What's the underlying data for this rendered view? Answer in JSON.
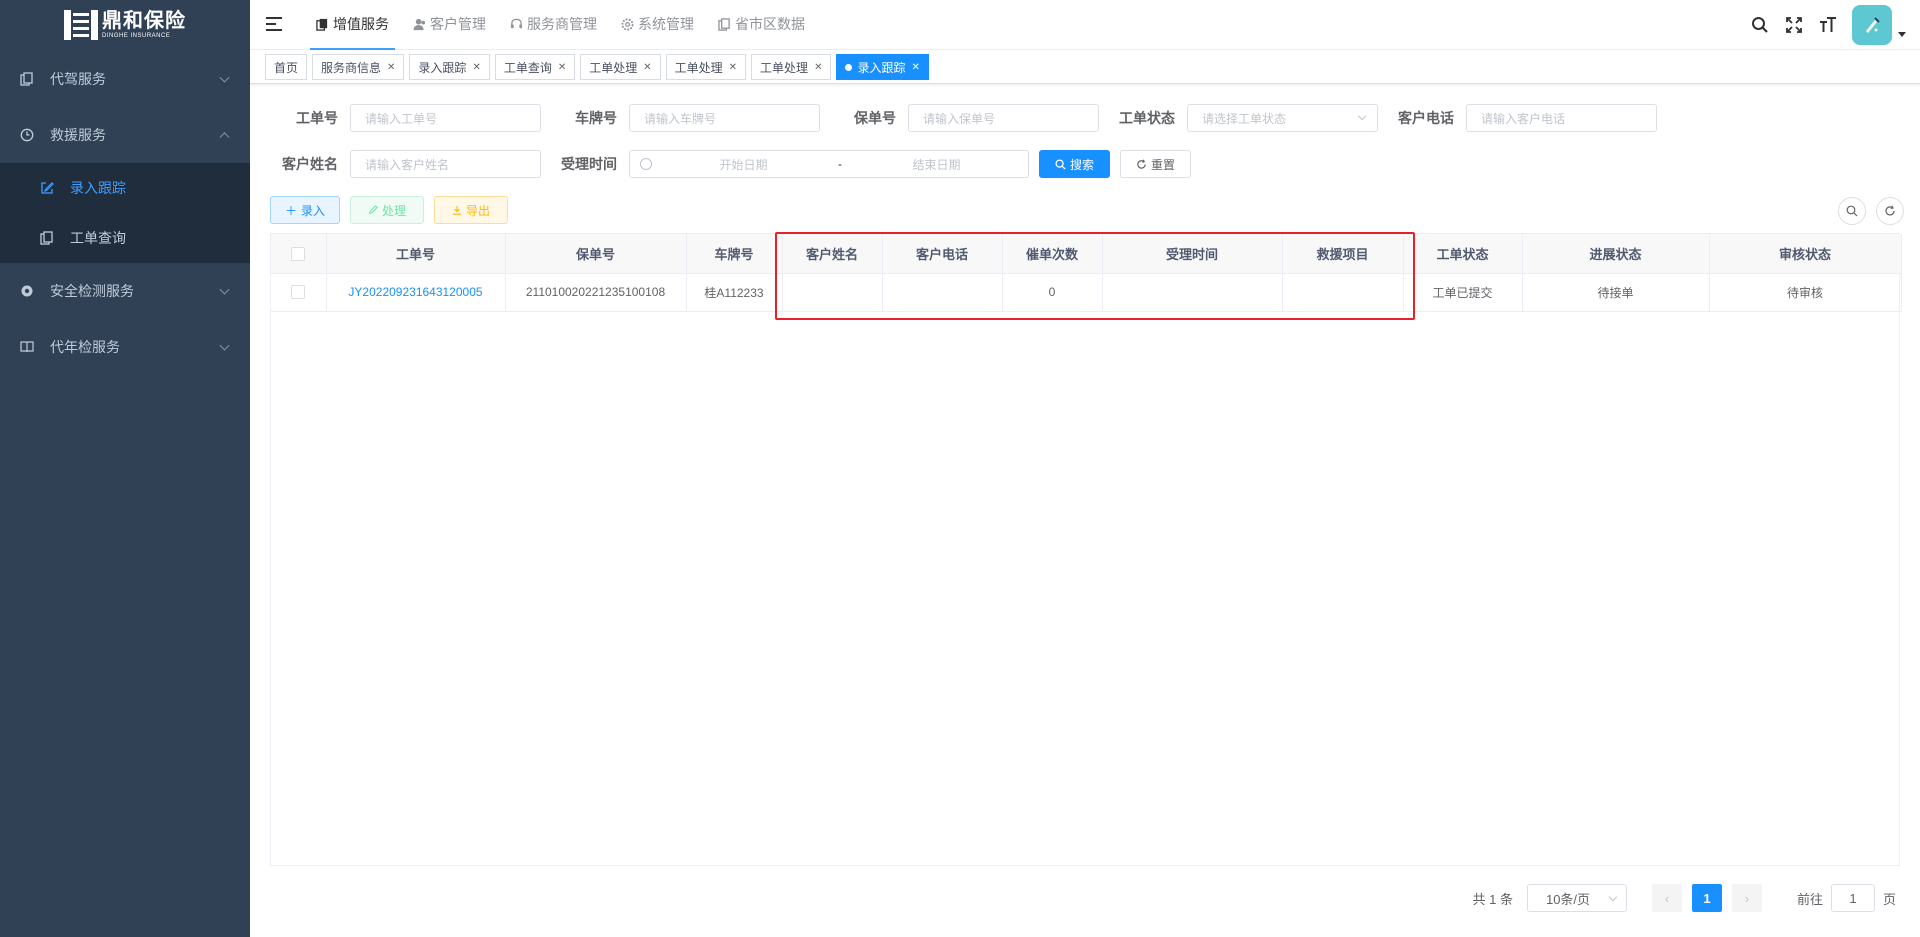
{
  "brand": {
    "name_cn": "鼎和保险",
    "name_en": "DINGHE INSURANCE"
  },
  "sidebar": {
    "items": [
      {
        "label": "代驾服务",
        "icon": "document-copy-icon",
        "expanded": false
      },
      {
        "label": "救援服务",
        "icon": "clock-icon",
        "expanded": true,
        "children": [
          {
            "label": "录入跟踪",
            "icon": "edit-icon",
            "active": true
          },
          {
            "label": "工单查询",
            "icon": "document-copy-icon",
            "active": false
          }
        ]
      },
      {
        "label": "安全检测服务",
        "icon": "gear-icon",
        "expanded": false
      },
      {
        "label": "代年检服务",
        "icon": "book-icon",
        "expanded": false
      }
    ]
  },
  "topnav": {
    "tabs": [
      {
        "label": "增值服务",
        "icon": "document-copy-icon",
        "active": true
      },
      {
        "label": "客户管理",
        "icon": "user-icon",
        "active": false
      },
      {
        "label": "服务商管理",
        "icon": "headset-icon",
        "active": false
      },
      {
        "label": "系统管理",
        "icon": "gear-icon",
        "active": false
      },
      {
        "label": "省市区数据",
        "icon": "document-copy-icon",
        "active": false
      }
    ],
    "right_icons": [
      "search-icon",
      "fullscreen-icon",
      "font-size-icon"
    ]
  },
  "tags": [
    {
      "label": "首页",
      "closable": false,
      "active": false
    },
    {
      "label": "服务商信息",
      "closable": true,
      "active": false
    },
    {
      "label": "录入跟踪",
      "closable": true,
      "active": false
    },
    {
      "label": "工单查询",
      "closable": true,
      "active": false
    },
    {
      "label": "工单处理",
      "closable": true,
      "active": false
    },
    {
      "label": "工单处理",
      "closable": true,
      "active": false
    },
    {
      "label": "工单处理",
      "closable": true,
      "active": false
    },
    {
      "label": "录入跟踪",
      "closable": true,
      "active": true
    }
  ],
  "search": {
    "work_order": {
      "label": "工单号",
      "placeholder": "请输入工单号"
    },
    "plate": {
      "label": "车牌号",
      "placeholder": "请输入车牌号"
    },
    "policy": {
      "label": "保单号",
      "placeholder": "请输入保单号"
    },
    "status": {
      "label": "工单状态",
      "placeholder": "请选择工单状态"
    },
    "phone": {
      "label": "客户电话",
      "placeholder": "请输入客户电话"
    },
    "name": {
      "label": "客户姓名",
      "placeholder": "请输入客户姓名"
    },
    "accept_time": {
      "label": "受理时间",
      "start_placeholder": "开始日期",
      "separator": "-",
      "end_placeholder": "结束日期"
    },
    "search_btn": "搜索",
    "reset_btn": "重置"
  },
  "toolbar": {
    "add": "录入",
    "process": "处理",
    "export": "导出"
  },
  "table": {
    "columns": [
      "工单号",
      "保单号",
      "车牌号",
      "客户姓名",
      "客户电话",
      "催单次数",
      "受理时间",
      "救援项目",
      "工单状态",
      "进展状态",
      "审核状态"
    ],
    "rows": [
      {
        "work_order": "JY202209231643120005",
        "policy": "211010020221235100108",
        "plate": "桂A112233",
        "name": "",
        "phone": "",
        "urge_count": "0",
        "accept_time": "",
        "project": "",
        "status": "工单已提交",
        "progress": "待接单",
        "audit": "待审核"
      }
    ]
  },
  "pagination": {
    "total_text": "共 1 条",
    "page_size": "10条/页",
    "current_page": "1",
    "goto_label": "前往",
    "goto_value": "1",
    "page_unit": "页"
  },
  "colors": {
    "sidebar_bg": "#304156",
    "primary": "#1890ff",
    "highlight_box": "#e8202a"
  }
}
